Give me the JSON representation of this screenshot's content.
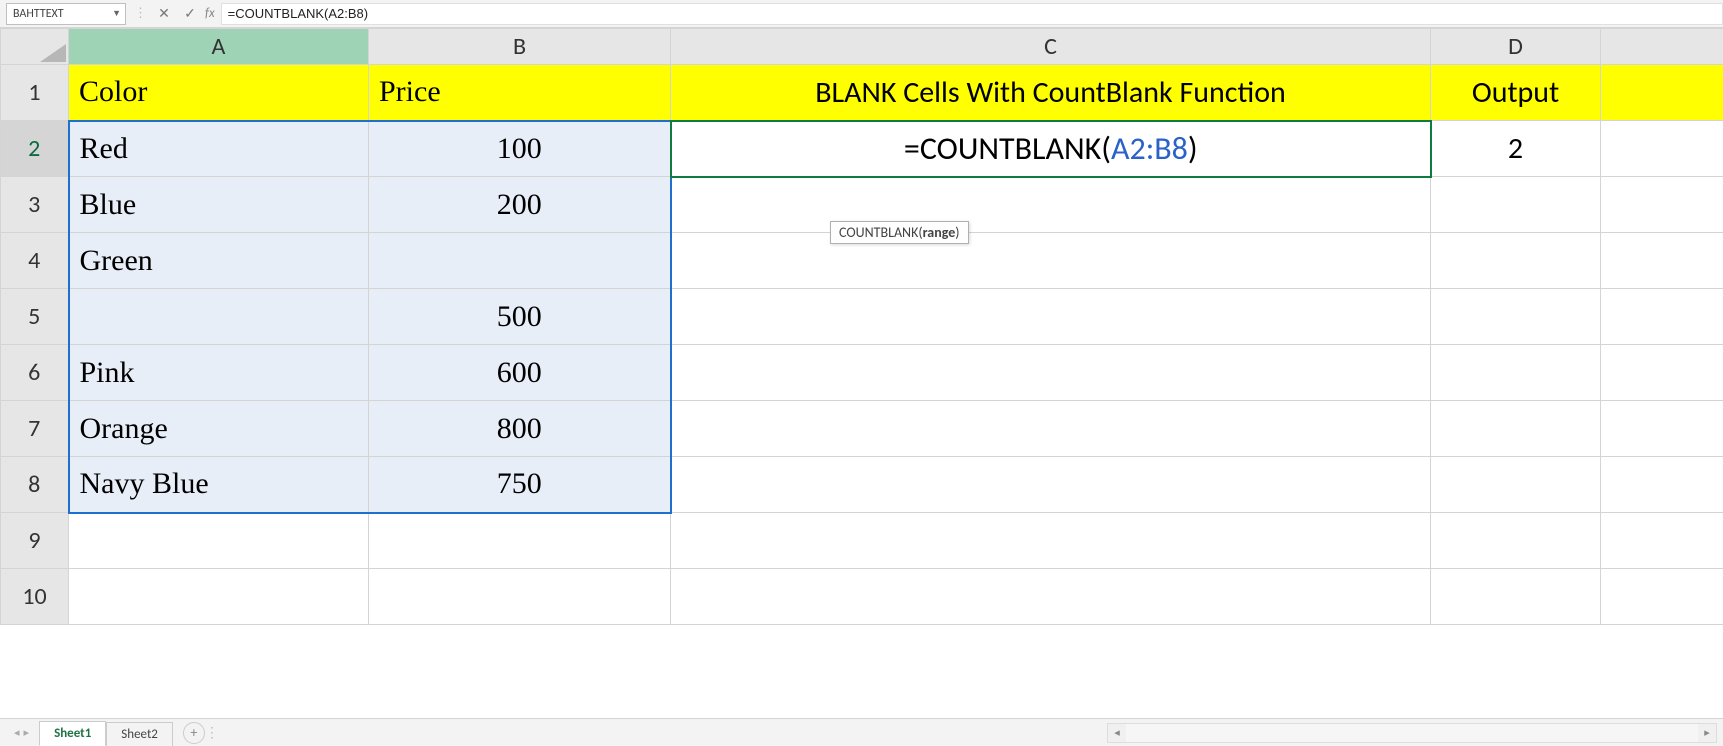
{
  "formula_bar": {
    "name_box": "BAHTTEXT",
    "cancel_icon": "✕",
    "enter_icon": "✓",
    "fx_label": "fx",
    "formula": "=COUNTBLANK(A2:B8)"
  },
  "columns": {
    "A": "A",
    "B": "B",
    "C": "C",
    "D": "D",
    "E": ""
  },
  "rows": [
    "1",
    "2",
    "3",
    "4",
    "5",
    "6",
    "7",
    "8",
    "9",
    "10"
  ],
  "headers": {
    "A": "Color",
    "B": "Price",
    "C": "BLANK Cells With CountBlank Function",
    "D": "Output"
  },
  "data": {
    "colors": [
      "Red",
      "Blue",
      "Green",
      "",
      "Pink",
      "Orange",
      "Navy Blue"
    ],
    "prices": [
      "100",
      "200",
      "",
      "500",
      "600",
      "800",
      "750"
    ]
  },
  "editing_cell": {
    "prefix": "=COUNTBLANK(",
    "ref": "A2:B8",
    "suffix": ")"
  },
  "output_value": "2",
  "tooltip": {
    "fn": "COUNTBLANK(",
    "arg": "range",
    "close": ")"
  },
  "tabs": {
    "sheet1": "Sheet1",
    "sheet2": "Sheet2",
    "new": "+"
  },
  "nav": {
    "left": "◂",
    "right": "▸"
  }
}
